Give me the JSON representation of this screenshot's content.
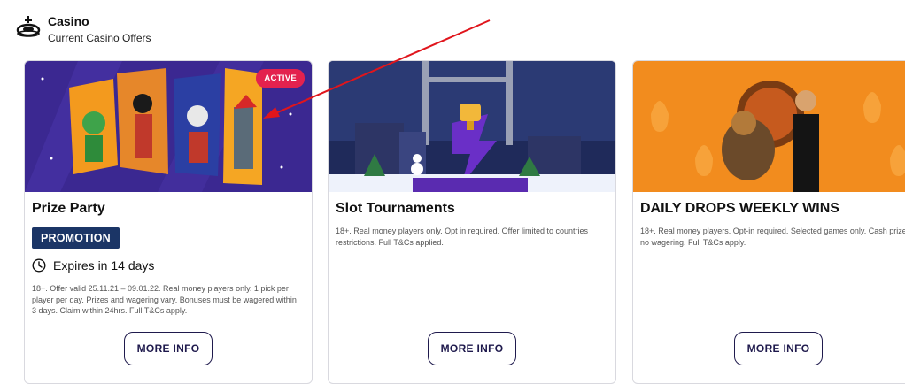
{
  "header": {
    "title": "Casino",
    "subtitle": "Current Casino Offers",
    "icon": "roulette-icon"
  },
  "cards": [
    {
      "title": "Prize Party",
      "badge": "PROMOTION",
      "status": "ACTIVE",
      "expires": "Expires in 14 days",
      "terms": "18+. Offer valid 25.11.21 – 09.01.22. Real money players only. 1 pick per player per day. Prizes and wagering vary. Bonuses must be wagered within 3 days. Claim within 24hrs. Full T&Cs apply.",
      "button": "MORE INFO"
    },
    {
      "title": "Slot Tournaments",
      "terms": "18+. Real money players only. Opt in required. Offer limited to countries restrictions. Full T&Cs applied.",
      "button": "MORE INFO"
    },
    {
      "title": "DAILY DROPS WEEKLY WINS",
      "terms": "18+. Real money players. Opt-in required. Selected games only. Cash prizes, no wagering. Full T&Cs apply.",
      "button": "MORE INFO"
    }
  ],
  "colors": {
    "promotion_badge": "#1b3566",
    "active_badge": "#e3224e",
    "button_border": "#1f1a4d",
    "annotation_arrow": "#e0151c"
  }
}
